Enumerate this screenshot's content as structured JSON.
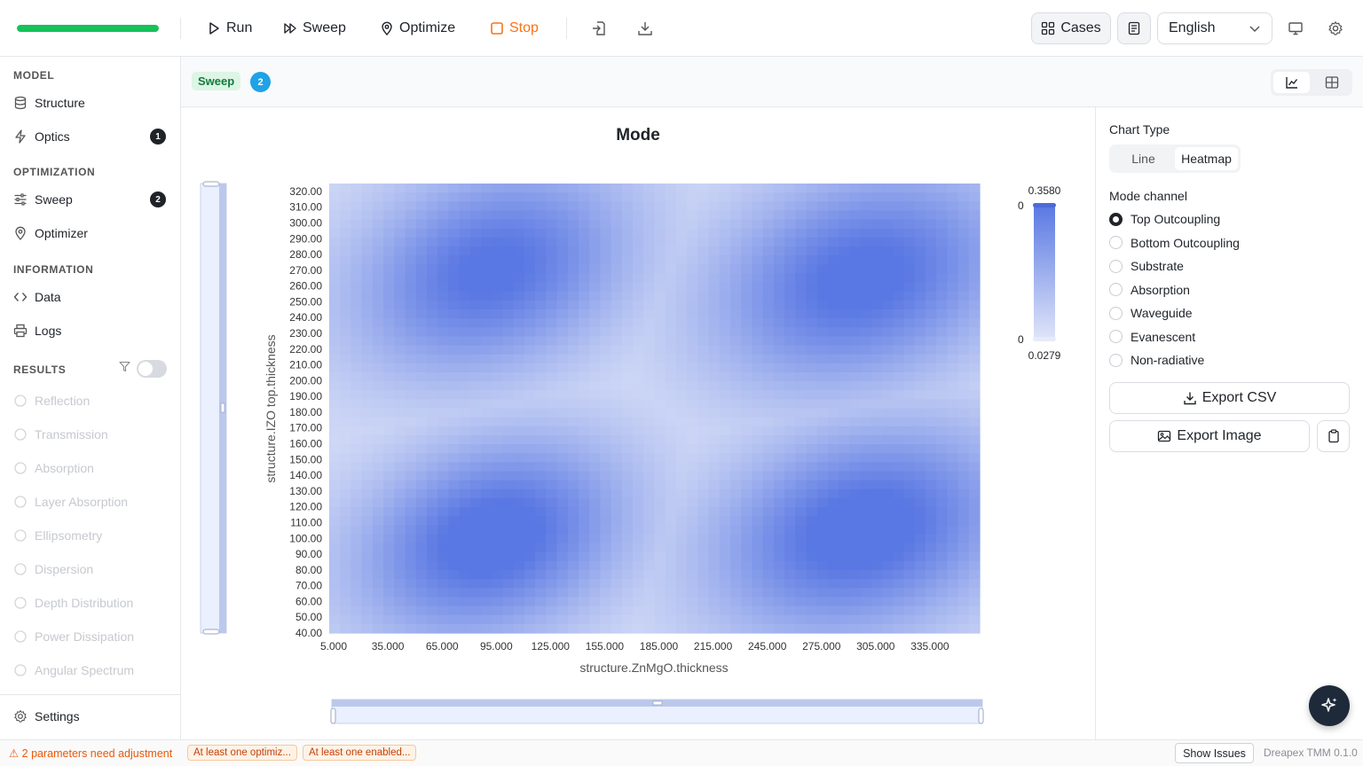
{
  "toolbar": {
    "progress": 1.0,
    "run": "Run",
    "sweep": "Sweep",
    "optimize": "Optimize",
    "stop": "Stop",
    "cases": "Cases",
    "language": "English"
  },
  "sidebar": {
    "model_header": "MODEL",
    "structure": "Structure",
    "optics": "Optics",
    "optics_badge": "1",
    "optimization_header": "OPTIMIZATION",
    "sweep": "Sweep",
    "sweep_badge": "2",
    "optimizer": "Optimizer",
    "information_header": "INFORMATION",
    "data": "Data",
    "logs": "Logs",
    "results_header": "RESULTS",
    "results": [
      "Reflection",
      "Transmission",
      "Absorption",
      "Layer Absorption",
      "Ellipsometry",
      "Dispersion",
      "Depth Distribution",
      "Power Dissipation",
      "Angular Spectrum"
    ],
    "settings": "Settings"
  },
  "subheader": {
    "chip": "Sweep",
    "badge": "2"
  },
  "chart_data": {
    "type": "heatmap",
    "title": "Mode",
    "xlabel": "structure.ZnMgO.thickness",
    "ylabel": "structure.IZO top.thickness",
    "x_ticks": [
      "5.000",
      "35.000",
      "65.000",
      "95.000",
      "125.000",
      "155.000",
      "185.000",
      "215.000",
      "245.000",
      "275.000",
      "305.000",
      "335.000"
    ],
    "y_ticks": [
      "320.00",
      "310.00",
      "300.00",
      "290.00",
      "280.00",
      "270.00",
      "260.00",
      "250.00",
      "240.00",
      "230.00",
      "220.00",
      "210.00",
      "200.00",
      "190.00",
      "180.00",
      "170.00",
      "160.00",
      "150.00",
      "140.00",
      "130.00",
      "120.00",
      "110.00",
      "100.00",
      "90.00",
      "80.00",
      "70.00",
      "60.00",
      "50.00",
      "40.00"
    ],
    "xlim": [
      5,
      365
    ],
    "ylim": [
      40,
      325
    ],
    "colorscale_min": "0.0279",
    "colorscale_max": "0.3580",
    "colorscale_min_label": "0",
    "colorscale_max_label": "0",
    "color_low": "#dfe5f8",
    "color_high": "#5a78e3"
  },
  "panel": {
    "chart_type_label": "Chart Type",
    "chart_type_options": [
      "Line",
      "Heatmap"
    ],
    "mode_channel_label": "Mode channel",
    "mode_channels": [
      "Top Outcoupling",
      "Bottom Outcoupling",
      "Substrate",
      "Absorption",
      "Waveguide",
      "Evanescent",
      "Non-radiative"
    ],
    "export_csv": "Export CSV",
    "export_image": "Export Image"
  },
  "status": {
    "warning": "⚠ 2 parameters need adjustment",
    "chip1": "At least one optimiz...",
    "chip2": "At least one enabled...",
    "show_issues": "Show Issues",
    "version": "Dreapex TMM 0.1.0"
  }
}
